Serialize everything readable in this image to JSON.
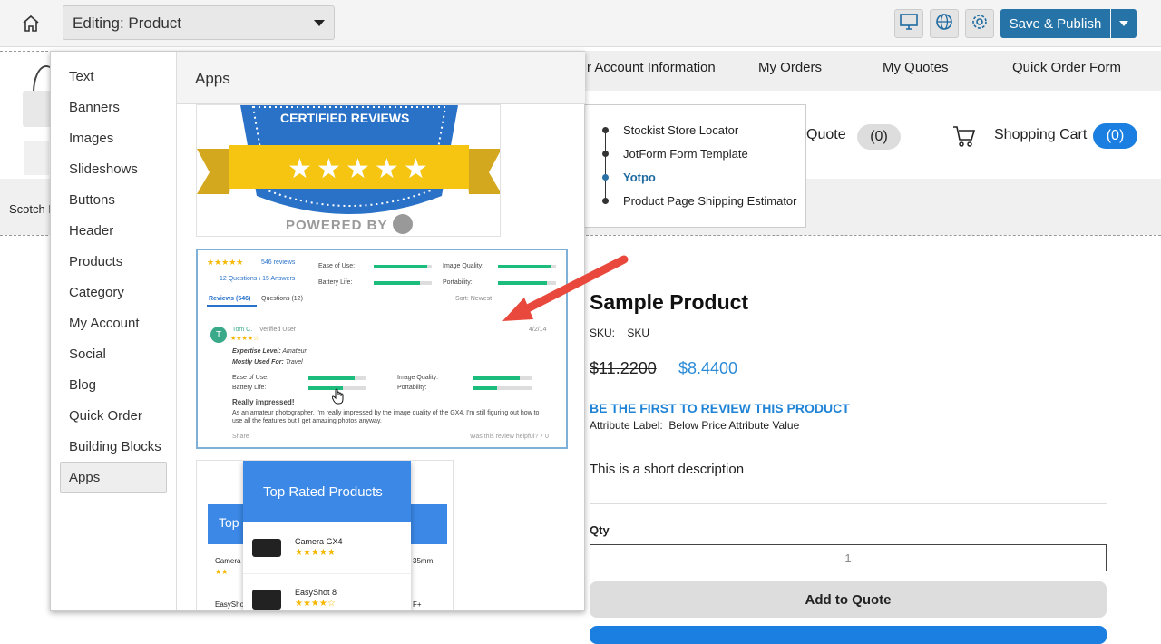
{
  "toolbar": {
    "editing_label": "Editing: Product",
    "save_label": "Save & Publish",
    "icons": [
      "home-icon",
      "desktop-icon",
      "globe-icon",
      "gear-icon"
    ]
  },
  "nav": {
    "items": [
      "r Account Information",
      "My Orders",
      "My Quotes",
      "Quick Order Form"
    ]
  },
  "header": {
    "quote_label": "Quote",
    "quote_count": "(0)",
    "cart_label": "Shopping Cart",
    "cart_count": "(0)",
    "scotch": "Scotch E"
  },
  "submenu": {
    "items": [
      "Stockist Store Locator",
      "JotForm Form Template",
      "Yotpo",
      "Product Page Shipping Estimator"
    ],
    "active_index": 2
  },
  "panel": {
    "categories": [
      "Text",
      "Banners",
      "Images",
      "Slideshows",
      "Buttons",
      "Header",
      "Products",
      "Category",
      "My Account",
      "Social",
      "Blog",
      "Quick Order",
      "Building Blocks",
      "Apps"
    ],
    "selected": "Apps",
    "title": "Apps"
  },
  "card1": {
    "badge_text": "CERTIFIED REVIEWS",
    "powered": "POWERED BY"
  },
  "card2": {
    "review_count": "546 reviews",
    "questions": "12 Questions \\ 15 Answers",
    "ease": "Ease of Use:",
    "image_quality": "Image Quality:",
    "battery": "Battery Life:",
    "portability": "Portability:",
    "tab_reviews": "Reviews",
    "tab_reviews_count": "(546)",
    "tab_questions": "Questions (12)",
    "sort": "Sort:",
    "sort_value": "Newest",
    "reviewer_initial": "T",
    "reviewer": "Tom C.",
    "verified": "Verified User",
    "date": "4/2/14",
    "expertise_label": "Expertise Level:",
    "expertise": "Amateur",
    "used_label": "Mostly Used For:",
    "used": "Travel",
    "review_title": "Really impressed!",
    "review_body": "As an amateur photographer, I'm really impressed by the image quality of the GX4. I'm still figuring out how to use all the features but I get amazing photos anyway.",
    "share": "Share",
    "helpful": "Was this review helpful?",
    "helpful_yes": "7",
    "helpful_no": "0"
  },
  "card3": {
    "title": "Top Rated Products",
    "behind_title": "Top",
    "products": [
      {
        "name": "Camera GX4",
        "rating": "★★★★★"
      },
      {
        "name": "EasyShot 8",
        "rating": "★★★★☆"
      }
    ],
    "behind_rows": [
      "Camera",
      "EasyShot"
    ],
    "side_texts": [
      "35mm",
      "F+"
    ]
  },
  "product": {
    "title": "Sample Product",
    "sku_label": "SKU:",
    "sku": "SKU",
    "old_price": "$11.2200",
    "new_price": "$8.4400",
    "review_link": "BE THE FIRST TO REVIEW THIS PRODUCT",
    "attr_label": "Attribute Label:",
    "attr_value": "Below Price Attribute Value",
    "description": "This is a short description",
    "qty_label": "Qty",
    "qty_value": "1",
    "add_quote": "Add to Quote"
  },
  "colors": {
    "primary": "#2673a8",
    "cart_blue": "#1a7fe0",
    "link_blue": "#1f83d6",
    "arrow": "#e8493c",
    "star": "#f5b800"
  }
}
